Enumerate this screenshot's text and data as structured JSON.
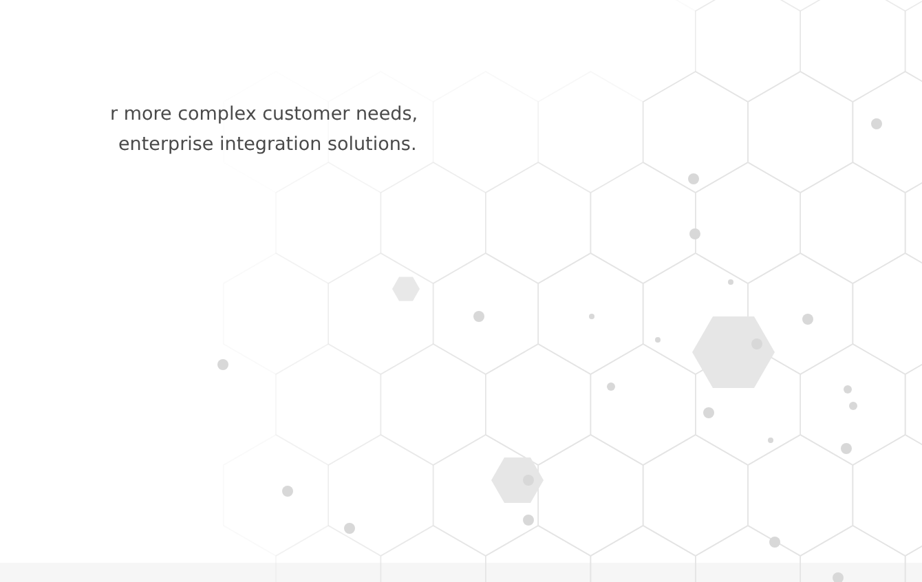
{
  "intro": {
    "lines": [
      "r more complex customer needs,",
      "enterprise integration solutions."
    ]
  }
}
